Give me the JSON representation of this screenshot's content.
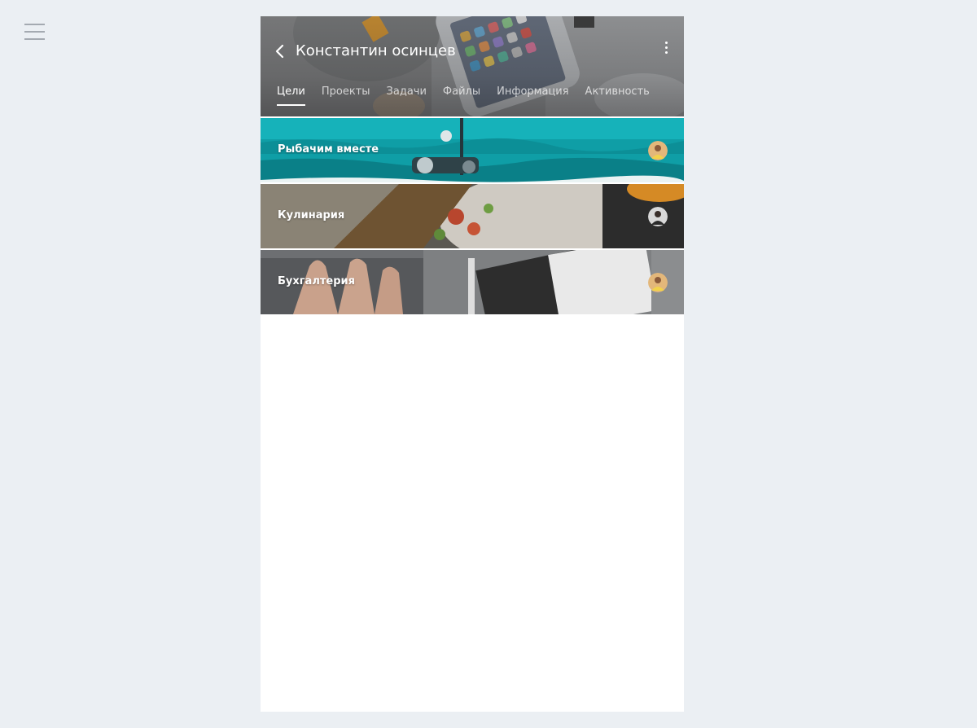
{
  "header": {
    "title": "Константин осинцев",
    "back_icon": "chevron-left-icon",
    "more_icon": "vertical-dots-icon"
  },
  "tabs": [
    {
      "label": "Цели",
      "active": true
    },
    {
      "label": "Проекты",
      "active": false
    },
    {
      "label": "Задачи",
      "active": false
    },
    {
      "label": "Файлы",
      "active": false
    },
    {
      "label": "Информация",
      "active": false
    },
    {
      "label": "Активность",
      "active": false
    }
  ],
  "goals": [
    {
      "title": "Рыбачим вместе",
      "theme": "sea",
      "avatar": "avatar-yellow"
    },
    {
      "title": "Кулинария",
      "theme": "food",
      "avatar": "avatar-dark"
    },
    {
      "title": "Бухгалтерия",
      "theme": "desk",
      "avatar": "avatar-yellow"
    }
  ],
  "colors": {
    "page_bg": "#ebeff3",
    "panel_bg": "#ffffff",
    "menu_icon": "#a4aab1"
  }
}
